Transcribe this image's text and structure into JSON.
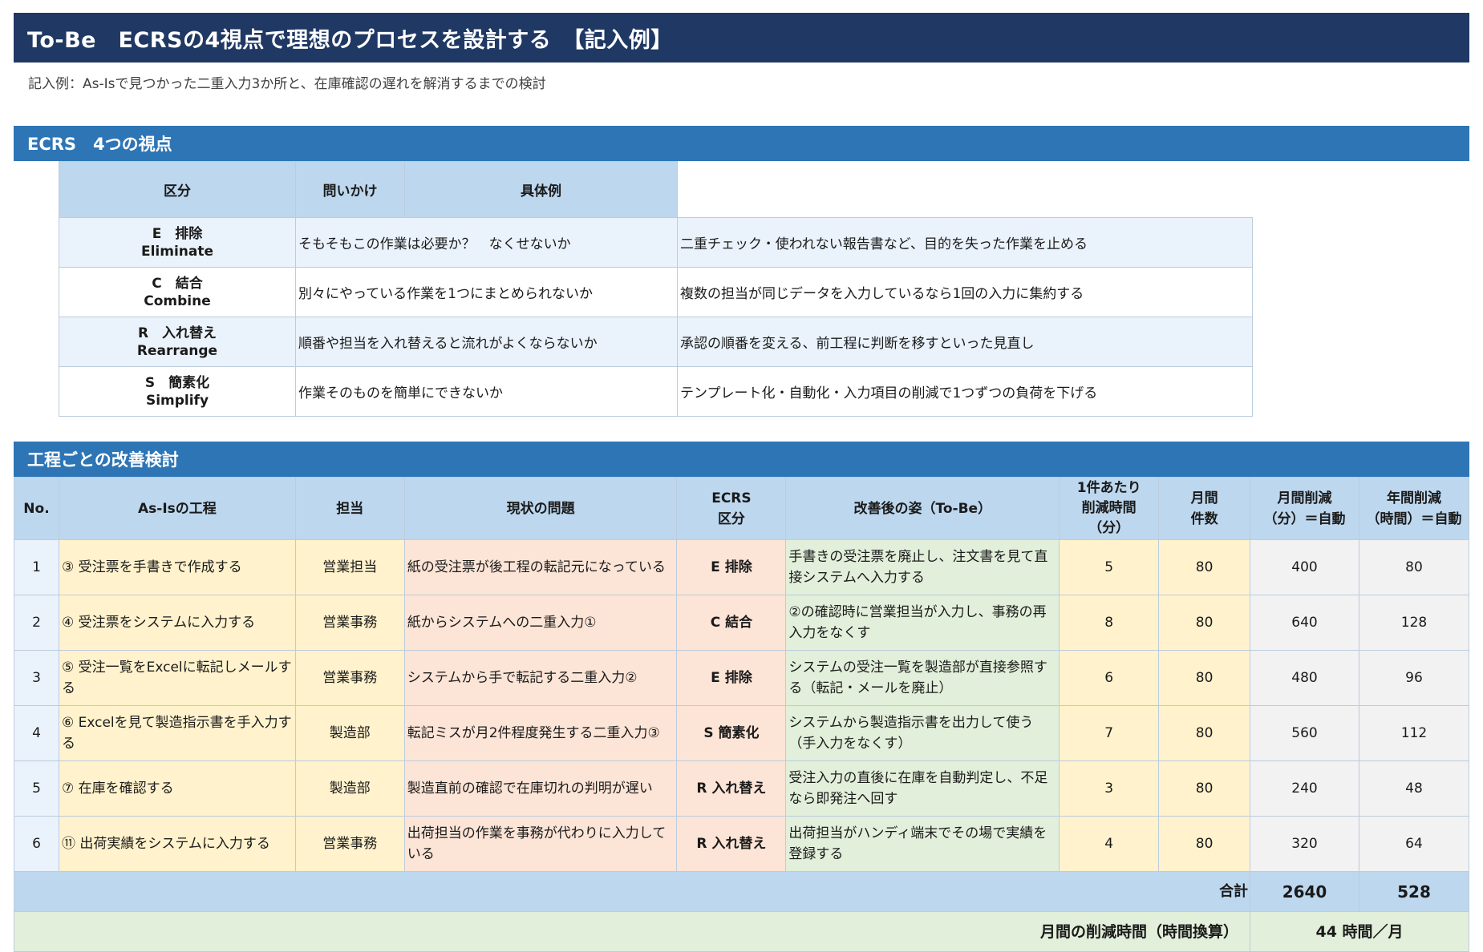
{
  "header": {
    "title": "To-Be　ECRSの4視点で理想のプロセスを設計する　【記入例】",
    "subtitle": "記入例：As-Isで見つかった二重入力3か所と、在庫確認の遅れを解消するまでの検討"
  },
  "ecrs_section": {
    "title": "ECRS　4つの視点",
    "headers": [
      "区分",
      "問いかけ",
      "具体例"
    ],
    "rows": [
      {
        "cat_jp": "E　排除",
        "cat_en": "Eliminate",
        "question": "そもそもこの作業は必要か？　なくせないか",
        "example": "二重チェック・使われない報告書など、目的を失った作業を止める"
      },
      {
        "cat_jp": "C　結合",
        "cat_en": "Combine",
        "question": "別々にやっている作業を1つにまとめられないか",
        "example": "複数の担当が同じデータを入力しているなら1回の入力に集約する"
      },
      {
        "cat_jp": "R　入れ替え",
        "cat_en": "Rearrange",
        "question": "順番や担当を入れ替えると流れがよくならないか",
        "example": "承認の順番を変える、前工程に判断を移すといった見直し"
      },
      {
        "cat_jp": "S　簡素化",
        "cat_en": "Simplify",
        "question": "作業そのものを簡単にできないか",
        "example": "テンプレート化・自動化・入力項目の削減で1つずつの負荷を下げる"
      }
    ]
  },
  "improve_section": {
    "title": "工程ごとの改善検討",
    "headers": {
      "no": "No.",
      "step": "As-Isの工程",
      "owner": "担当",
      "problem": "現状の問題",
      "ecrs_1": "ECRS",
      "ecrs_2": "区分",
      "tobe": "改善後の姿（To-Be）",
      "min_1": "1件あたり",
      "min_2": "削減時間",
      "min_3": "（分）",
      "cnt_1": "月間",
      "cnt_2": "件数",
      "mon_1": "月間削減",
      "mon_2": "（分）＝自動",
      "yr_1": "年間削減",
      "yr_2": "（時間）＝自動"
    },
    "rows": [
      {
        "no": "1",
        "step": "③ 受注票を手書きで作成する",
        "owner": "営業担当",
        "problem": "紙の受注票が後工程の転記元になっている",
        "ecrs": "E 排除",
        "tobe": "手書きの受注票を廃止し、注文書を見て直接システムへ入力する",
        "minutes": "5",
        "count": "80",
        "monthly": "400",
        "yearly": "80"
      },
      {
        "no": "2",
        "step": "④ 受注票をシステムに入力する",
        "owner": "営業事務",
        "problem": "紙からシステムへの二重入力①",
        "ecrs": "C 結合",
        "tobe": "②の確認時に営業担当が入力し、事務の再入力をなくす",
        "minutes": "8",
        "count": "80",
        "monthly": "640",
        "yearly": "128"
      },
      {
        "no": "3",
        "step": "⑤ 受注一覧をExcelに転記しメールする",
        "owner": "営業事務",
        "problem": "システムから手で転記する二重入力②",
        "ecrs": "E 排除",
        "tobe": "システムの受注一覧を製造部が直接参照する（転記・メールを廃止）",
        "minutes": "6",
        "count": "80",
        "monthly": "480",
        "yearly": "96"
      },
      {
        "no": "4",
        "step": "⑥ Excelを見て製造指示書を手入力する",
        "owner": "製造部",
        "problem": "転記ミスが月2件程度発生する二重入力③",
        "ecrs": "S 簡素化",
        "tobe": "システムから製造指示書を出力して使う（手入力をなくす）",
        "minutes": "7",
        "count": "80",
        "monthly": "560",
        "yearly": "112"
      },
      {
        "no": "5",
        "step": "⑦ 在庫を確認する",
        "owner": "製造部",
        "problem": "製造直前の確認で在庫切れの判明が遅い",
        "ecrs": "R 入れ替え",
        "tobe": "受注入力の直後に在庫を自動判定し、不足なら即発注へ回す",
        "minutes": "3",
        "count": "80",
        "monthly": "240",
        "yearly": "48"
      },
      {
        "no": "6",
        "step": "⑪ 出荷実績をシステムに入力する",
        "owner": "営業事務",
        "problem": "出荷担当の作業を事務が代わりに入力している",
        "ecrs": "R 入れ替え",
        "tobe": "出荷担当がハンディ端末でその場で実績を登録する",
        "minutes": "4",
        "count": "80",
        "monthly": "320",
        "yearly": "64"
      }
    ],
    "total": {
      "label": "合計",
      "monthly": "2640",
      "yearly": "528"
    },
    "monthly_hours": {
      "label": "月間の削減時間（時間換算）",
      "value": "44 時間／月"
    }
  }
}
